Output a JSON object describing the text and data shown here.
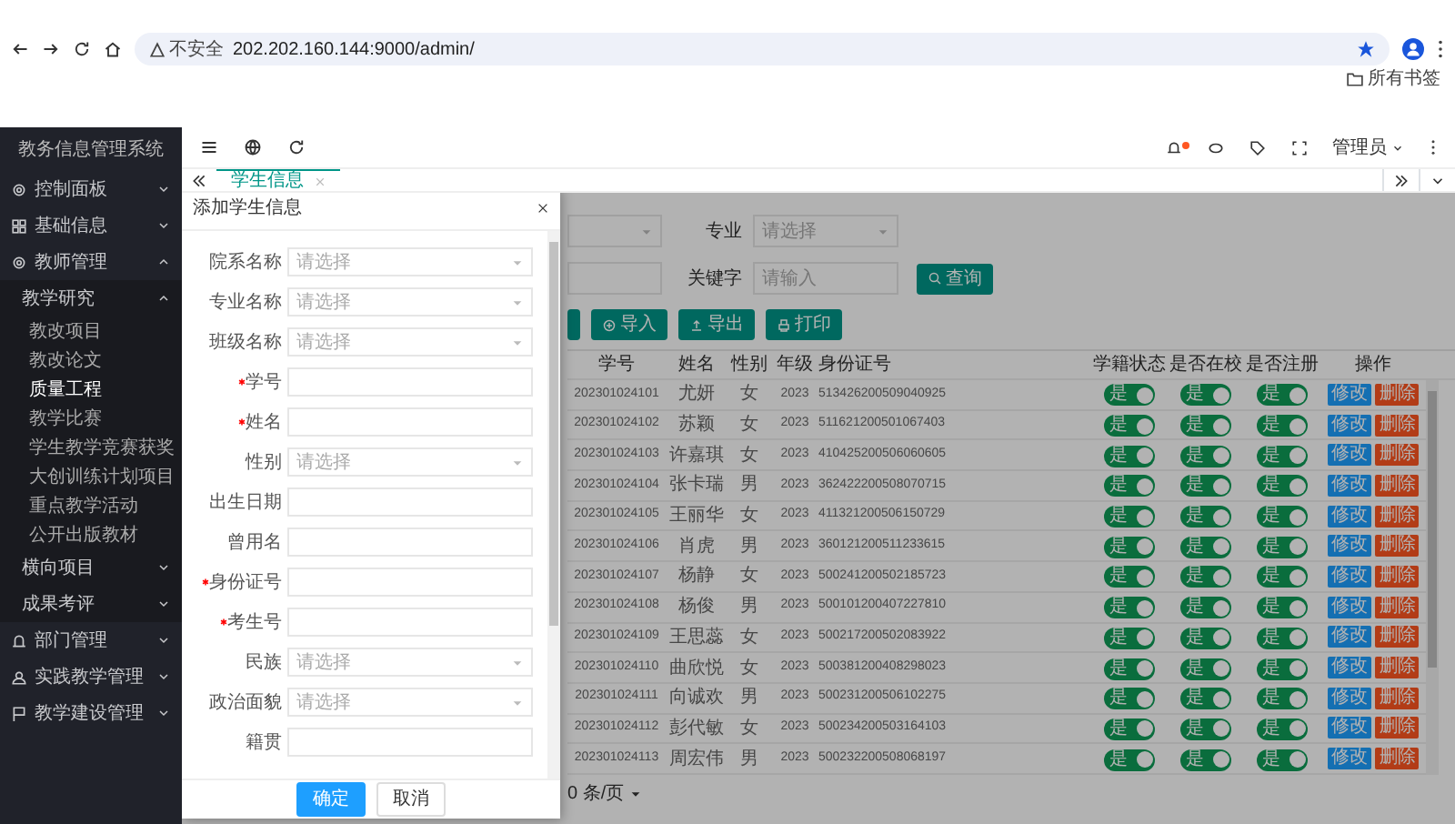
{
  "browser": {
    "security": "不安全",
    "url": "202.202.160.144:9000/admin/",
    "bookmarks": "所有书签"
  },
  "app": {
    "title": "教务信息管理系统",
    "user": "管理员"
  },
  "sidebar": [
    {
      "label": "控制面板",
      "expanded": false
    },
    {
      "label": "基础信息",
      "expanded": false
    },
    {
      "label": "教师管理",
      "expanded": true,
      "children": [
        {
          "label": "教学研究",
          "expanded": true,
          "children": [
            {
              "label": "教改项目",
              "selected": false
            },
            {
              "label": "教改论文",
              "selected": false
            },
            {
              "label": "质量工程",
              "selected": true
            },
            {
              "label": "教学比赛",
              "selected": false
            },
            {
              "label": "学生教学竞赛获奖",
              "selected": false
            },
            {
              "label": "大创训练计划项目",
              "selected": false
            },
            {
              "label": "重点教学活动",
              "selected": false
            },
            {
              "label": "公开出版教材",
              "selected": false
            }
          ]
        },
        {
          "label": "横向项目",
          "expanded": false
        },
        {
          "label": "成果考评",
          "expanded": false
        }
      ]
    },
    {
      "label": "部门管理",
      "expanded": false
    },
    {
      "label": "实践教学管理",
      "expanded": false
    },
    {
      "label": "教学建设管理",
      "expanded": false
    }
  ],
  "tabs": [
    {
      "label": "学生信息",
      "selected": true
    }
  ],
  "filters": [
    {
      "label": "专业",
      "kind": "select",
      "placeholder": "请选择"
    },
    {
      "label": "关键字",
      "kind": "input",
      "placeholder": "请输入"
    }
  ],
  "search_button": "查询",
  "toolbar": [
    "导入",
    "导出",
    "打印"
  ],
  "table": {
    "columns": [
      "学号",
      "姓名",
      "性别",
      "年级",
      "身份证号",
      "学籍状态",
      "是否在校",
      "是否注册",
      "操作"
    ],
    "rows": [
      {
        "cells": [
          "202301024101",
          "尤妍",
          "女",
          "2023",
          "513426200509040925"
        ],
        "switches": [
          {
            "text": "是",
            "on": true
          },
          {
            "text": "是",
            "on": true
          },
          {
            "text": "是",
            "on": true
          }
        ],
        "actions": [
          "修改",
          "删除"
        ]
      },
      {
        "cells": [
          "202301024102",
          "苏颖",
          "女",
          "2023",
          "511621200501067403"
        ],
        "switches": [
          {
            "text": "是",
            "on": true
          },
          {
            "text": "是",
            "on": true
          },
          {
            "text": "是",
            "on": true
          }
        ],
        "actions": [
          "修改",
          "删除"
        ]
      },
      {
        "cells": [
          "202301024103",
          "许嘉琪",
          "女",
          "2023",
          "410425200506060605"
        ],
        "switches": [
          {
            "text": "是",
            "on": true
          },
          {
            "text": "是",
            "on": true
          },
          {
            "text": "是",
            "on": true
          }
        ],
        "actions": [
          "修改",
          "删除"
        ]
      },
      {
        "cells": [
          "202301024104",
          "张卡瑞",
          "男",
          "2023",
          "362422200508070715"
        ],
        "switches": [
          {
            "text": "是",
            "on": true
          },
          {
            "text": "是",
            "on": true
          },
          {
            "text": "是",
            "on": true
          }
        ],
        "actions": [
          "修改",
          "删除"
        ]
      },
      {
        "cells": [
          "202301024105",
          "王丽华",
          "女",
          "2023",
          "411321200506150729"
        ],
        "switches": [
          {
            "text": "是",
            "on": true
          },
          {
            "text": "是",
            "on": true
          },
          {
            "text": "是",
            "on": true
          }
        ],
        "actions": [
          "修改",
          "删除"
        ]
      },
      {
        "cells": [
          "202301024106",
          "肖虎",
          "男",
          "2023",
          "360121200511233615"
        ],
        "switches": [
          {
            "text": "是",
            "on": true
          },
          {
            "text": "是",
            "on": true
          },
          {
            "text": "是",
            "on": true
          }
        ],
        "actions": [
          "修改",
          "删除"
        ]
      },
      {
        "cells": [
          "202301024107",
          "杨静",
          "女",
          "2023",
          "500241200502185723"
        ],
        "switches": [
          {
            "text": "是",
            "on": true
          },
          {
            "text": "是",
            "on": true
          },
          {
            "text": "是",
            "on": true
          }
        ],
        "actions": [
          "修改",
          "删除"
        ]
      },
      {
        "cells": [
          "202301024108",
          "杨俊",
          "男",
          "2023",
          "500101200407227810"
        ],
        "switches": [
          {
            "text": "是",
            "on": true
          },
          {
            "text": "是",
            "on": true
          },
          {
            "text": "是",
            "on": true
          }
        ],
        "actions": [
          "修改",
          "删除"
        ]
      },
      {
        "cells": [
          "202301024109",
          "王思蕊",
          "女",
          "2023",
          "500217200502083922"
        ],
        "switches": [
          {
            "text": "是",
            "on": true
          },
          {
            "text": "是",
            "on": true
          },
          {
            "text": "是",
            "on": true
          }
        ],
        "actions": [
          "修改",
          "删除"
        ]
      },
      {
        "cells": [
          "202301024110",
          "曲欣悦",
          "女",
          "2023",
          "500381200408298023"
        ],
        "switches": [
          {
            "text": "是",
            "on": true
          },
          {
            "text": "是",
            "on": true
          },
          {
            "text": "是",
            "on": true
          }
        ],
        "actions": [
          "修改",
          "删除"
        ]
      },
      {
        "cells": [
          "202301024111",
          "向诚欢",
          "男",
          "2023",
          "500231200506102275"
        ],
        "switches": [
          {
            "text": "是",
            "on": true
          },
          {
            "text": "是",
            "on": true
          },
          {
            "text": "是",
            "on": true
          }
        ],
        "actions": [
          "修改",
          "删除"
        ]
      },
      {
        "cells": [
          "202301024112",
          "彭代敏",
          "女",
          "2023",
          "500234200503164103"
        ],
        "switches": [
          {
            "text": "是",
            "on": true
          },
          {
            "text": "是",
            "on": true
          },
          {
            "text": "是",
            "on": true
          }
        ],
        "actions": [
          "修改",
          "删除"
        ]
      },
      {
        "cells": [
          "202301024113",
          "周宏伟",
          "男",
          "2023",
          "500232200508068197"
        ],
        "switches": [
          {
            "text": "是",
            "on": true
          },
          {
            "text": "是",
            "on": true
          },
          {
            "text": "是",
            "on": true
          }
        ],
        "actions": [
          "修改",
          "删除"
        ]
      }
    ]
  },
  "pagination": {
    "page_size": "0 条/页"
  },
  "modal": {
    "title": "添加学生信息",
    "fields": [
      {
        "label": "院系名称",
        "kind": "select",
        "required": false,
        "placeholder": "请选择"
      },
      {
        "label": "专业名称",
        "kind": "select",
        "required": false,
        "placeholder": "请选择"
      },
      {
        "label": "班级名称",
        "kind": "select",
        "required": false,
        "placeholder": "请选择"
      },
      {
        "label": "学号",
        "kind": "input",
        "required": true
      },
      {
        "label": "姓名",
        "kind": "input",
        "required": true
      },
      {
        "label": "性别",
        "kind": "select",
        "required": false,
        "placeholder": "请选择"
      },
      {
        "label": "出生日期",
        "kind": "input",
        "required": false
      },
      {
        "label": "曾用名",
        "kind": "input",
        "required": false
      },
      {
        "label": "身份证号",
        "kind": "input",
        "required": true
      },
      {
        "label": "考生号",
        "kind": "input",
        "required": true
      },
      {
        "label": "民族",
        "kind": "select",
        "required": false,
        "placeholder": "请选择"
      },
      {
        "label": "政治面貌",
        "kind": "select",
        "required": false,
        "placeholder": "请选择"
      },
      {
        "label": "籍贯",
        "kind": "input",
        "required": false
      }
    ],
    "buttons": [
      {
        "label": "确定",
        "kind": "primary"
      },
      {
        "label": "取消",
        "kind": "secondary"
      }
    ]
  }
}
